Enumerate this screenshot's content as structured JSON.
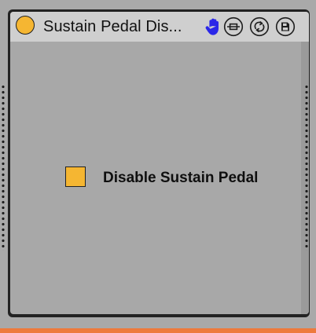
{
  "device": {
    "title": "Sustain Pedal Dis...",
    "icons": {
      "power": "power-toggle-icon",
      "hand": "hand-icon",
      "map": "map-icon",
      "hot_swap": "hot-swap-icon",
      "save": "save-icon"
    }
  },
  "control": {
    "label": "Disable Sustain Pedal",
    "checked": true
  },
  "colors": {
    "accent": "#f5b632",
    "hand_icon": "#2b27e8",
    "panel": "#a8a8a8",
    "title_bar": "#cfcfcf",
    "bottom_strip": "#ee7a3c"
  }
}
